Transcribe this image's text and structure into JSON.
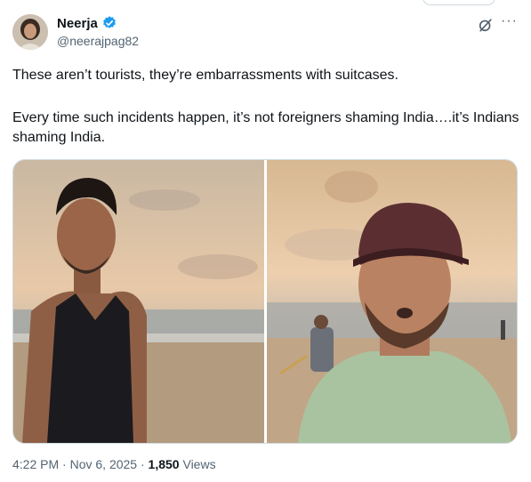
{
  "author": {
    "name": "Neerja",
    "handle": "@neerajpag82",
    "verified_color": "#1d9bf0"
  },
  "tweet": {
    "line1": "These aren’t tourists, they’re embarrassments with suitcases.",
    "line2": "Every time such incidents happen, it’s not foreigners shaming India….it’s Indians shaming India."
  },
  "icons": {
    "verified": "verified-badge-icon",
    "grok": "grok-icon",
    "more": "more-icon"
  },
  "more_label": "···",
  "footer": {
    "time": "4:22 PM",
    "sep1": " · ",
    "date": "Nov 6, 2025",
    "sep2": " · ",
    "views_count": "1,850",
    "views_label": " Views"
  },
  "colors": {
    "text": "#0f1419",
    "secondary": "#536471",
    "accent": "#1d9bf0"
  }
}
